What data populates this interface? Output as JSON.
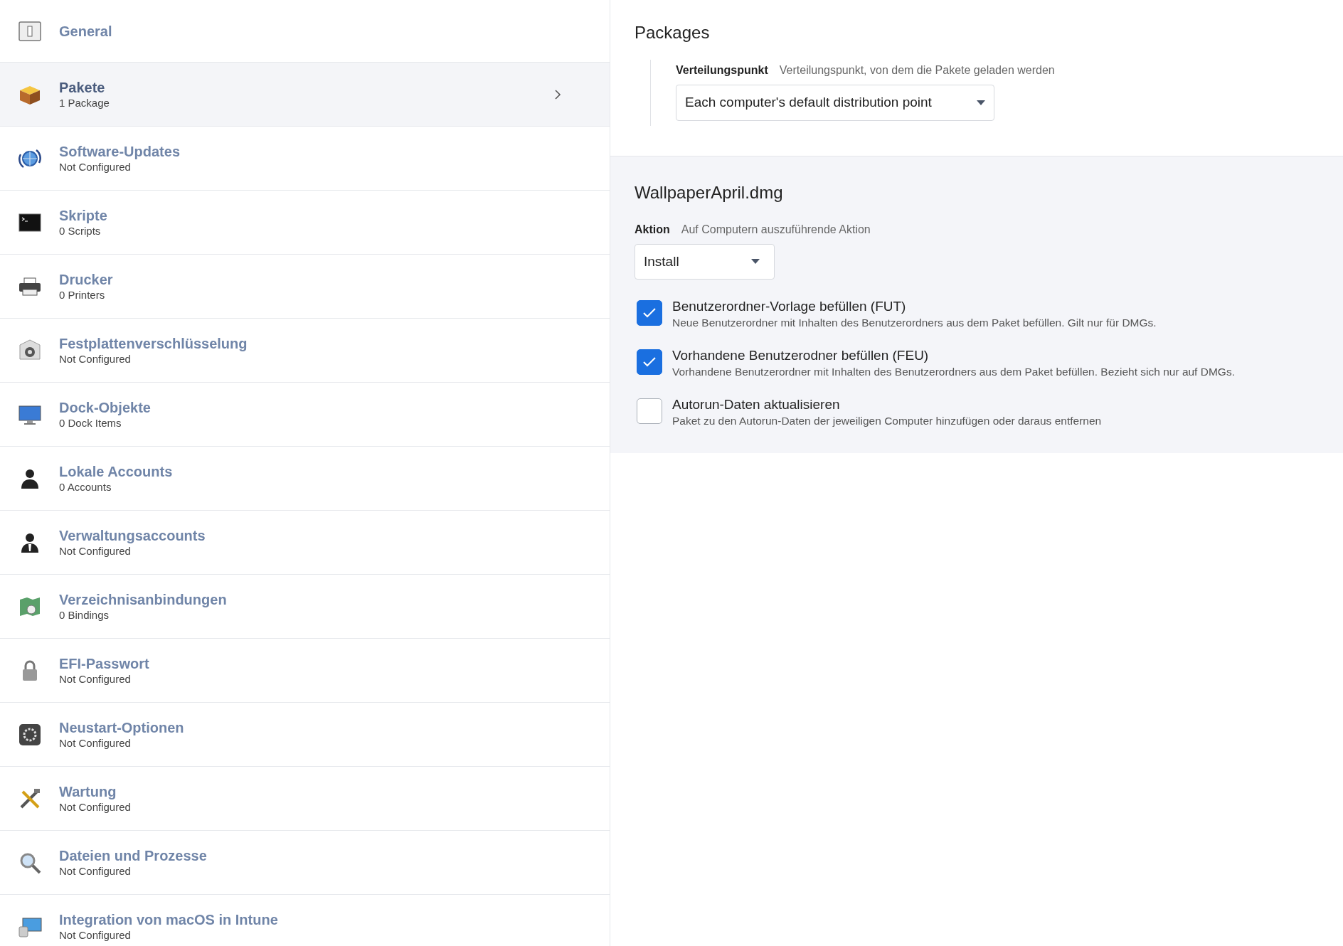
{
  "sidebar": {
    "items": [
      {
        "title": "General",
        "selected": false
      },
      {
        "title": "Pakete",
        "subtitle": "1 Package",
        "selected": true
      },
      {
        "title": "Software-Updates",
        "subtitle": "Not Configured",
        "selected": false
      },
      {
        "title": "Skripte",
        "subtitle": "0 Scripts",
        "selected": false
      },
      {
        "title": "Drucker",
        "subtitle": "0 Printers",
        "selected": false
      },
      {
        "title": "Festplattenverschlüsselung",
        "subtitle": "Not Configured",
        "selected": false
      },
      {
        "title": "Dock-Objekte",
        "subtitle": "0 Dock Items",
        "selected": false
      },
      {
        "title": "Lokale Accounts",
        "subtitle": "0 Accounts",
        "selected": false
      },
      {
        "title": "Verwaltungsaccounts",
        "subtitle": "Not Configured",
        "selected": false
      },
      {
        "title": "Verzeichnisanbindungen",
        "subtitle": "0 Bindings",
        "selected": false
      },
      {
        "title": "EFI-Passwort",
        "subtitle": "Not Configured",
        "selected": false
      },
      {
        "title": "Neustart-Optionen",
        "subtitle": "Not Configured",
        "selected": false
      },
      {
        "title": "Wartung",
        "subtitle": "Not Configured",
        "selected": false
      },
      {
        "title": "Dateien und Prozesse",
        "subtitle": "Not Configured",
        "selected": false
      },
      {
        "title": "Integration von macOS in Intune",
        "subtitle": "Not Configured",
        "selected": false
      }
    ]
  },
  "packages": {
    "title": "Packages",
    "distribution": {
      "label": "Verteilungspunkt",
      "hint": "Verteilungspunkt, von dem die Pakete geladen werden",
      "value": "Each computer's default distribution point"
    }
  },
  "package": {
    "title": "WallpaperApril.dmg",
    "action": {
      "label": "Aktion",
      "hint": "Auf Computern auszuführende Aktion",
      "value": "Install"
    },
    "options": [
      {
        "label": "Benutzerordner-Vorlage befüllen (FUT)",
        "description": "Neue Benutzerordner mit Inhalten des Benutzerordners aus dem Paket befüllen. Gilt nur für DMGs.",
        "checked": true
      },
      {
        "label": "Vorhandene Benutzerodner befüllen (FEU)",
        "description": "Vorhandene Benutzerordner mit Inhalten des Benutzerordners aus dem Paket befüllen. Bezieht sich nur auf DMGs.",
        "checked": true
      },
      {
        "label": "Autorun-Daten aktualisieren",
        "description": "Paket zu den Autorun-Daten der jeweiligen Computer hinzufügen oder daraus entfernen",
        "checked": false
      }
    ]
  }
}
